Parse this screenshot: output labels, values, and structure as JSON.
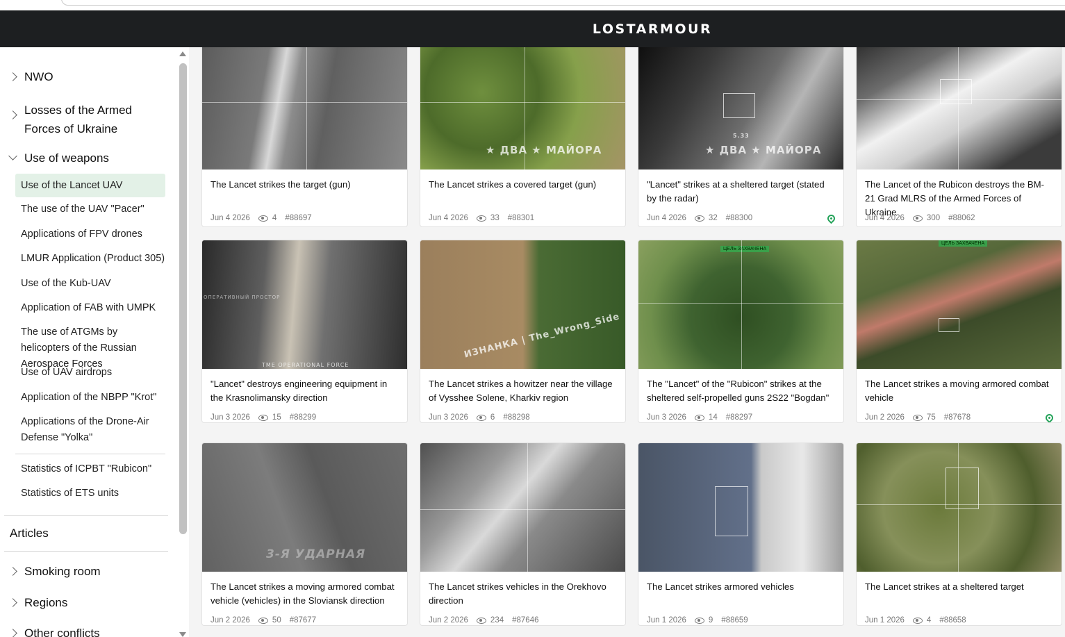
{
  "app": {
    "logo": "LOSTARMOUR"
  },
  "sidebar": {
    "top_items": [
      {
        "label": "NWO"
      },
      {
        "label": "Losses of the Armed Forces of Ukraine"
      },
      {
        "label": "Use of weapons"
      }
    ],
    "weapons_items": [
      {
        "label": "Use of the Lancet UAV",
        "active": true
      },
      {
        "label": "The use of the UAV \"Pacer\""
      },
      {
        "label": "Applications of FPV drones"
      },
      {
        "label": "LMUR Application (Product 305)"
      },
      {
        "label": "Use of the Kub-UAV"
      },
      {
        "label": "Application of FAB with UMPK"
      },
      {
        "label": "The use of ATGMs by helicopters of the Russian Aerospace Forces"
      },
      {
        "label": "Use of UAV airdrops"
      },
      {
        "label": "Application of the NBPP \"Krot\""
      },
      {
        "label": "Applications of the Drone-Air Defense \"Yolka\""
      }
    ],
    "stats_items": [
      {
        "label": "Statistics of ICPBT \"Rubicon\""
      },
      {
        "label": "Statistics of ETS units"
      }
    ],
    "articles_label": "Articles",
    "bottom_items": [
      {
        "label": "Smoking room"
      },
      {
        "label": "Regions"
      },
      {
        "label": "Other conflicts"
      }
    ]
  },
  "cards": [
    {
      "title": "The Lancet strikes the target (gun)",
      "date": "Jun 4 2026",
      "views": "4",
      "id": "#88697",
      "pin": false
    },
    {
      "title": "The Lancet strikes a covered target (gun)",
      "date": "Jun 4 2026",
      "views": "33",
      "id": "#88301",
      "pin": false
    },
    {
      "title": "\"Lancet\" strikes at a sheltered target (stated by the radar)",
      "date": "Jun 4 2026",
      "views": "32",
      "id": "#88300",
      "pin": true
    },
    {
      "title": "The Lancet of the Rubicon destroys the BM-21 Grad MLRS of the Armed Forces of Ukraine",
      "date": "Jun 4 2026",
      "views": "300",
      "id": "#88062",
      "pin": false
    },
    {
      "title": "\"Lancet\" destroys engineering equipment in the Krasnolimansky direction",
      "date": "Jun 3 2026",
      "views": "15",
      "id": "#88299",
      "pin": false
    },
    {
      "title": "The Lancet strikes a howitzer near the village of Vysshee Solene, Kharkiv region",
      "date": "Jun 3 2026",
      "views": "6",
      "id": "#88298",
      "pin": false
    },
    {
      "title": "The \"Lancet\" of the \"Rubicon\" strikes at the sheltered self-propelled guns 2S22 \"Bogdan\"",
      "date": "Jun 3 2026",
      "views": "14",
      "id": "#88297",
      "pin": false
    },
    {
      "title": "The Lancet strikes a moving armored combat vehicle",
      "date": "Jun 2 2026",
      "views": "75",
      "id": "#87678",
      "pin": true
    },
    {
      "title": "The Lancet strikes a moving armored combat vehicle (vehicles) in the Sloviansk direction",
      "date": "Jun 2 2026",
      "views": "50",
      "id": "#87677",
      "pin": false
    },
    {
      "title": "The Lancet strikes vehicles in the Orekhovo direction",
      "date": "Jun 2 2026",
      "views": "234",
      "id": "#87646",
      "pin": false
    },
    {
      "title": "The Lancet strikes armored vehicles",
      "date": "Jun 1 2026",
      "views": "9",
      "id": "#88659",
      "pin": false
    },
    {
      "title": "The Lancet strikes at a sheltered target",
      "date": "Jun 1 2026",
      "views": "4",
      "id": "#88658",
      "pin": false
    }
  ],
  "thumb_overlays": {
    "dva_mayora": "★ ДВА ★ МАЙОРА",
    "izmanka": "ИЗНАНКА | The_Wrong_Side",
    "udarnaya": "3-Я УДАРНАЯ",
    "capture": "ЦЕЛЬ ЗАХВАЧЕНА",
    "radar": "5.33",
    "channel": "ОПЕРАТИВНЫЙ ПРОСТОР",
    "tme": "TME OPERATIONAL FORCE"
  },
  "colors": {
    "header_bg": "#1d1f21",
    "active_bg": "#e3f1e7",
    "pin": "#25a35a"
  }
}
